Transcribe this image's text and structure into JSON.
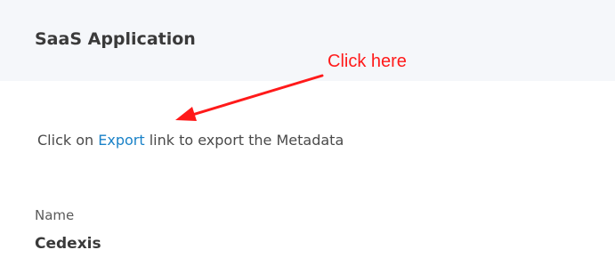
{
  "panel": {
    "title": "SaaS Application"
  },
  "annotation": {
    "label": "Click here",
    "color": "#ff1a1a"
  },
  "instruction": {
    "prefix": "Click on ",
    "link_text": "Export",
    "suffix": " link to export the Metadata"
  },
  "field": {
    "label": "Name",
    "value": "Cedexis"
  },
  "colors": {
    "header_bg": "#f5f7fa",
    "link": "#1a82c8"
  }
}
